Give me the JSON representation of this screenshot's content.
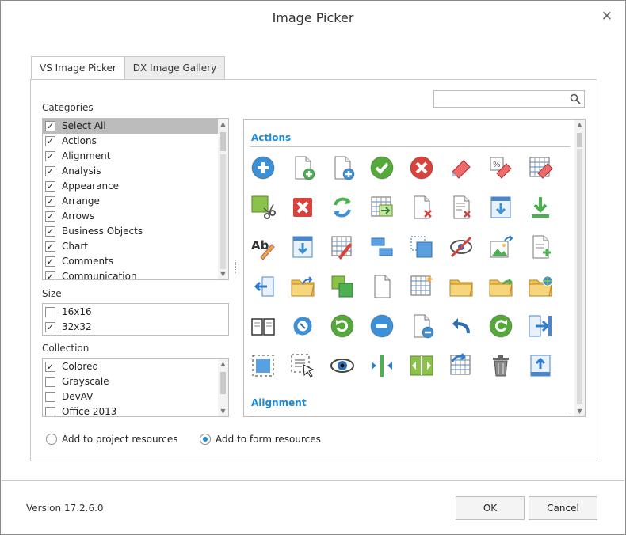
{
  "dialog": {
    "title": "Image Picker",
    "close_icon": "close-icon"
  },
  "tabs": [
    {
      "label": "VS Image Picker",
      "active": false
    },
    {
      "label": "DX Image Gallery",
      "active": true
    }
  ],
  "categories": {
    "label": "Categories",
    "items": [
      {
        "label": "Select All",
        "checked": true,
        "selected": true
      },
      {
        "label": "Actions",
        "checked": true
      },
      {
        "label": "Alignment",
        "checked": true
      },
      {
        "label": "Analysis",
        "checked": true
      },
      {
        "label": "Appearance",
        "checked": true
      },
      {
        "label": "Arrange",
        "checked": true
      },
      {
        "label": "Arrows",
        "checked": true
      },
      {
        "label": "Business Objects",
        "checked": true
      },
      {
        "label": "Chart",
        "checked": true
      },
      {
        "label": "Comments",
        "checked": true
      },
      {
        "label": "Communication",
        "checked": true
      }
    ]
  },
  "size": {
    "label": "Size",
    "items": [
      {
        "label": "16x16",
        "checked": false
      },
      {
        "label": "32x32",
        "checked": true
      }
    ]
  },
  "collection": {
    "label": "Collection",
    "items": [
      {
        "label": "Colored",
        "checked": true
      },
      {
        "label": "Grayscale",
        "checked": false
      },
      {
        "label": "DevAV",
        "checked": false
      },
      {
        "label": "Office 2013",
        "checked": false
      }
    ]
  },
  "search": {
    "value": "",
    "placeholder": "",
    "icon": "search-icon"
  },
  "gallery": {
    "groups": [
      {
        "name": "Actions"
      },
      {
        "name": "Alignment"
      }
    ],
    "icons": [
      "add-circle-icon",
      "new-document-icon",
      "add-file-icon",
      "apply-check-icon",
      "cancel-circle-icon",
      "eraser-icon",
      "clear-formatting-icon",
      "clear-table-icon",
      "cut-icon",
      "delete-x-icon",
      "refresh-icon",
      "table-insert-icon",
      "delete-document-icon",
      "delete-list-icon",
      "download-window-icon",
      "download-icon",
      "edit-text-icon",
      "export-window-icon",
      "edit-table-icon",
      "group-icon",
      "bring-to-front-icon",
      "hide-icon",
      "image-export-icon",
      "add-list-icon",
      "back-arrow-icon",
      "open-folder-icon",
      "copy-icon",
      "blank-document-icon",
      "new-table-icon",
      "folder-icon",
      "open-folder-arrow-icon",
      "open-folder-globe-icon",
      "open-book-icon",
      "reset-icon",
      "redo-icon",
      "remove-circle-icon",
      "remove-document-icon",
      "undo-icon",
      "reload-icon",
      "export-arrow-icon",
      "select-icon",
      "select-pointer-icon",
      "view-eye-icon",
      "split-vertical-icon",
      "fit-width-icon",
      "refresh-table-icon",
      "trash-icon",
      "upload-icon"
    ]
  },
  "resources": {
    "options": [
      {
        "label": "Add to project resources",
        "checked": false
      },
      {
        "label": "Add to form resources",
        "checked": true
      }
    ]
  },
  "footer": {
    "version": "Version 17.2.6.0",
    "ok_label": "OK",
    "cancel_label": "Cancel"
  },
  "colors": {
    "accent": "#1b8ad8",
    "selection": "#bcbcbc"
  }
}
